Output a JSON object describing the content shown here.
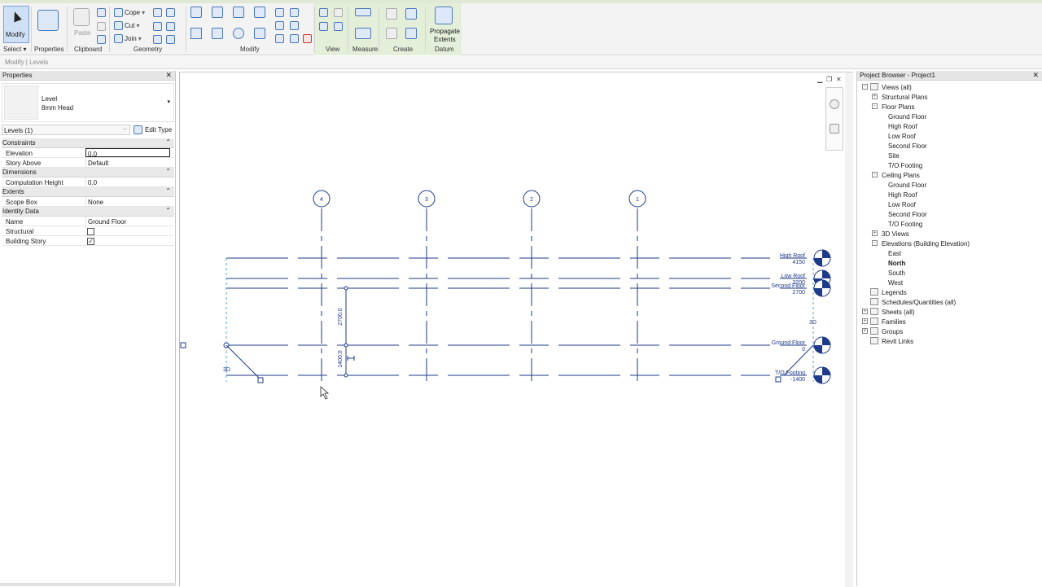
{
  "ribbon": {
    "select": {
      "modify_label": "Modify",
      "select_label": "Select ▾"
    },
    "properties_label": "Properties",
    "clipboard": {
      "paste_label": "Paste",
      "panel_label": "Clipboard"
    },
    "geometry": {
      "cope_label": "Cope",
      "cut_label": "Cut",
      "join_label": "Join",
      "panel_label": "Geometry"
    },
    "modify": {
      "panel_label": "Modify"
    },
    "view": {
      "panel_label": "View"
    },
    "measure": {
      "panel_label": "Measure"
    },
    "create": {
      "panel_label": "Create"
    },
    "datum": {
      "propagate_label_1": "Propagate",
      "propagate_label_2": "Extents",
      "panel_label": "Datum"
    }
  },
  "option_bar": {
    "context": "Modify | Levels"
  },
  "properties": {
    "title": "Properties",
    "type_family": "Level",
    "type_name": "8mm Head",
    "instance_filter": "Levels (1)",
    "edit_type_label": "Edit Type",
    "groups": [
      {
        "name": "Constraints",
        "rows": [
          {
            "key": "Elevation",
            "value": "0.0"
          },
          {
            "key": "Story Above",
            "value": "Default"
          }
        ]
      },
      {
        "name": "Dimensions",
        "rows": [
          {
            "key": "Computation Height",
            "value": "0.0"
          }
        ]
      },
      {
        "name": "Extents",
        "rows": [
          {
            "key": "Scope Box",
            "value": "None"
          }
        ]
      },
      {
        "name": "Identity Data",
        "rows": [
          {
            "key": "Name",
            "value": "Ground Floor"
          },
          {
            "key": "Structural",
            "value": ""
          },
          {
            "key": "Building Story",
            "value": ""
          }
        ]
      }
    ],
    "structural_checked": false,
    "building_story_checked": true
  },
  "canvas": {
    "grids": [
      "4",
      "3",
      "2",
      "1"
    ],
    "levels": [
      {
        "name": "High Roof",
        "elev": "4150"
      },
      {
        "name": "Low Roof",
        "elev": "3200"
      },
      {
        "name": "Second Floor",
        "elev": "2700"
      },
      {
        "name": "Ground Floor",
        "elev": "0"
      },
      {
        "name": "T/O Footing",
        "elev": "-1400"
      }
    ],
    "dims": [
      "2700.0",
      "1400.0"
    ],
    "tag_3d": "3D"
  },
  "browser": {
    "title": "Project Browser - Project1",
    "tree": [
      {
        "label": "Views (all)",
        "depth": 0,
        "exp": "-",
        "icon": true
      },
      {
        "label": "Structural Plans",
        "depth": 1,
        "exp": "+"
      },
      {
        "label": "Floor Plans",
        "depth": 1,
        "exp": "-"
      },
      {
        "label": "Ground Floor",
        "depth": 2
      },
      {
        "label": "High Roof",
        "depth": 2
      },
      {
        "label": "Low Roof",
        "depth": 2
      },
      {
        "label": "Second Floor",
        "depth": 2
      },
      {
        "label": "Site",
        "depth": 2
      },
      {
        "label": "T/O Footing",
        "depth": 2
      },
      {
        "label": "Ceiling Plans",
        "depth": 1,
        "exp": "-"
      },
      {
        "label": "Ground Floor",
        "depth": 2
      },
      {
        "label": "High Roof",
        "depth": 2
      },
      {
        "label": "Low Roof",
        "depth": 2
      },
      {
        "label": "Second Floor",
        "depth": 2
      },
      {
        "label": "T/O Footing",
        "depth": 2
      },
      {
        "label": "3D Views",
        "depth": 1,
        "exp": "+"
      },
      {
        "label": "Elevations (Building Elevation)",
        "depth": 1,
        "exp": "-"
      },
      {
        "label": "East",
        "depth": 2
      },
      {
        "label": "North",
        "depth": 2,
        "bold": true
      },
      {
        "label": "South",
        "depth": 2
      },
      {
        "label": "West",
        "depth": 2
      },
      {
        "label": "Legends",
        "depth": 0,
        "icon": true
      },
      {
        "label": "Schedules/Quantities (all)",
        "depth": 0,
        "icon": true
      },
      {
        "label": "Sheets (all)",
        "depth": 0,
        "exp": "+",
        "icon": true
      },
      {
        "label": "Families",
        "depth": 0,
        "exp": "+",
        "icon": true
      },
      {
        "label": "Groups",
        "depth": 0,
        "exp": "+",
        "icon": true
      },
      {
        "label": "Revit Links",
        "depth": 0,
        "icon": true
      }
    ]
  }
}
